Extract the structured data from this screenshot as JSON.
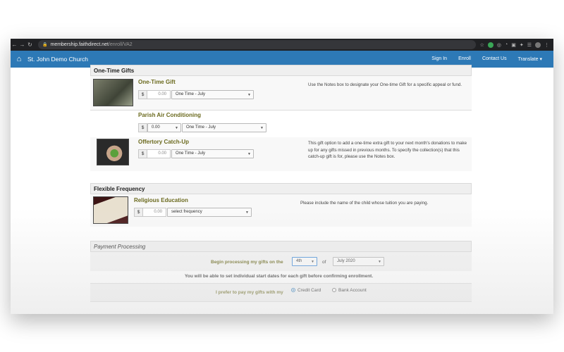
{
  "browser": {
    "url_host": "membership.faithdirect.net",
    "url_path": "/enroll/VA2"
  },
  "navbar": {
    "brand": "St. John Demo Church",
    "links": [
      "Sign In",
      "Enroll",
      "Contact Us",
      "Translate ▾"
    ]
  },
  "one_time": {
    "header": "One-Time Gifts",
    "gifts": [
      {
        "title": "One-Time Gift",
        "currency": "$",
        "amount": "0.00",
        "frequency": "One Time - July",
        "note": "Use the Notes box to designate your One-time Gift for a specific appeal or fund."
      },
      {
        "title": "Parish Air Conditioning",
        "currency": "$",
        "amount": "0.00",
        "frequency": "One Time - July",
        "note": ""
      },
      {
        "title": "Offertory Catch-Up",
        "currency": "$",
        "amount": "0.00",
        "frequency": "One Time - July",
        "note": "This gift option to add a one-time extra gift to your next month's donations to make up for any gifts missed in previous months. To specify the collection(s) that this catch-up gift is for, please use the Notes box."
      }
    ]
  },
  "flexible": {
    "header": "Flexible Frequency",
    "gift": {
      "title": "Religious Education",
      "currency": "$",
      "amount": "0.00",
      "frequency": "select frequency",
      "note": "Please include the name of the child whose tuition you are paying."
    }
  },
  "payment": {
    "header": "Payment Processing",
    "begin_label": "Begin processing my gifts on the",
    "day": "4th",
    "of": "of",
    "month": "July 2020",
    "info": "You will be able to set individual start dates for each gift before confirming enrollment.",
    "pay_label": "I prefer to pay my gifts with my",
    "options": [
      "Credit Card",
      "Bank Account"
    ],
    "selected": "Credit Card"
  },
  "colors": {
    "navbar": "#2d79b6",
    "gift_title": "#6b6a1e",
    "chrome": "#202124"
  }
}
